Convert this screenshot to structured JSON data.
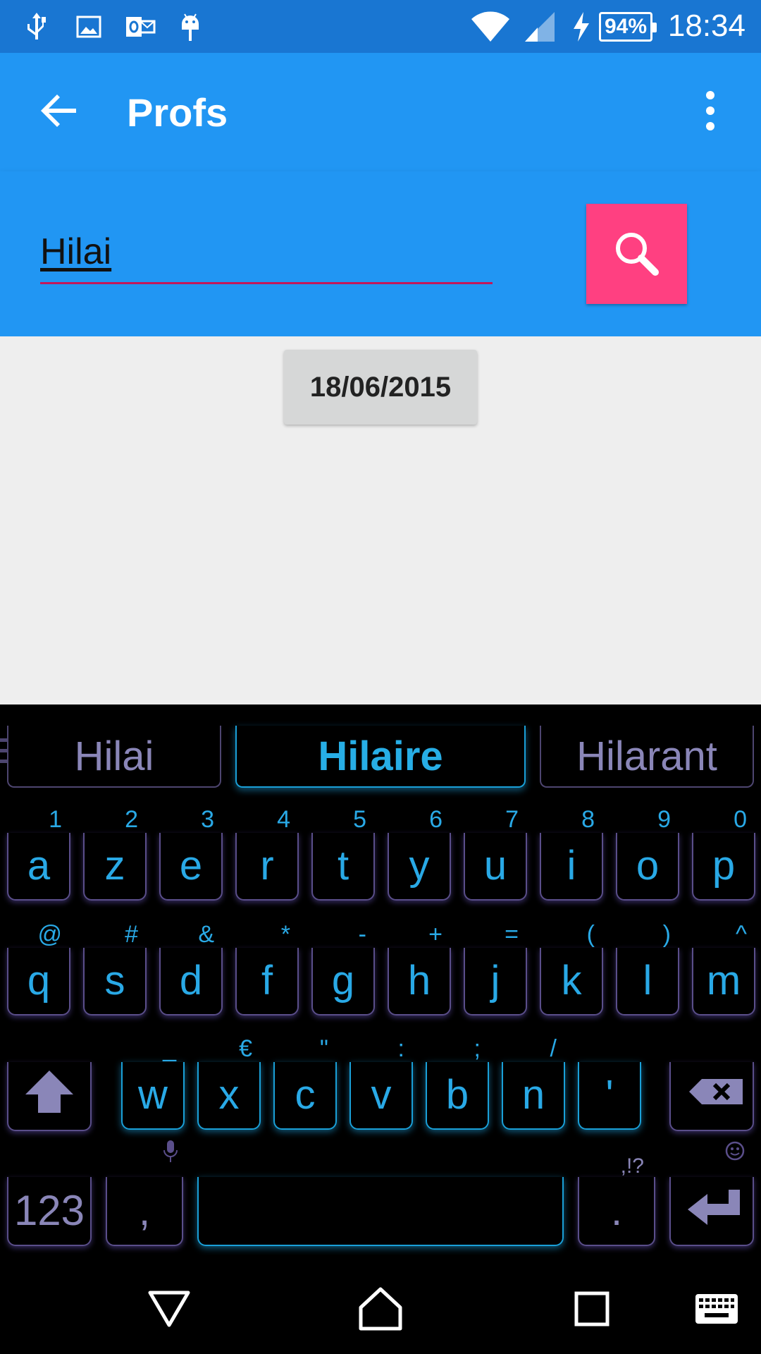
{
  "status_bar": {
    "battery_percent": "94%",
    "time": "18:34",
    "icons": [
      "usb-icon",
      "image-icon",
      "outlook-icon",
      "android-icon",
      "wifi-icon",
      "signal-icon",
      "charging-icon",
      "battery-icon"
    ]
  },
  "app_bar": {
    "title": "Profs",
    "back_icon": "arrow-left-icon",
    "menu_icon": "more-vert-icon"
  },
  "search": {
    "value": "Hilai",
    "button_icon": "search-icon"
  },
  "content": {
    "date_button": "18/06/2015"
  },
  "keyboard": {
    "suggestions": [
      "Hilai",
      "Hilaire",
      "Hilarant"
    ],
    "row1": [
      {
        "key": "a",
        "alt": "1"
      },
      {
        "key": "z",
        "alt": "2"
      },
      {
        "key": "e",
        "alt": "3"
      },
      {
        "key": "r",
        "alt": "4"
      },
      {
        "key": "t",
        "alt": "5"
      },
      {
        "key": "y",
        "alt": "6"
      },
      {
        "key": "u",
        "alt": "7"
      },
      {
        "key": "i",
        "alt": "8"
      },
      {
        "key": "o",
        "alt": "9"
      },
      {
        "key": "p",
        "alt": "0"
      }
    ],
    "row2": [
      {
        "key": "q",
        "alt": "@"
      },
      {
        "key": "s",
        "alt": "#"
      },
      {
        "key": "d",
        "alt": "&"
      },
      {
        "key": "f",
        "alt": "*"
      },
      {
        "key": "g",
        "alt": "-"
      },
      {
        "key": "h",
        "alt": "+"
      },
      {
        "key": "j",
        "alt": "="
      },
      {
        "key": "k",
        "alt": "("
      },
      {
        "key": "l",
        "alt": ")"
      },
      {
        "key": "m",
        "alt": "^"
      }
    ],
    "row3": [
      {
        "key": "w",
        "alt": "_"
      },
      {
        "key": "x",
        "alt": "€"
      },
      {
        "key": "c",
        "alt": "\""
      },
      {
        "key": "v",
        "alt": ":"
      },
      {
        "key": "b",
        "alt": ";"
      },
      {
        "key": "n",
        "alt": "/"
      },
      {
        "key": "'",
        "alt": ""
      }
    ],
    "row4": {
      "numbers": "123",
      "comma": ",",
      "period": ".",
      "period_alt": ",!?"
    }
  },
  "nav_bar": {
    "icons": [
      "back-triangle-icon",
      "home-icon",
      "recents-icon",
      "keyboard-icon"
    ]
  },
  "colors": {
    "status_bar": "#1976D2",
    "app_bar": "#2196F3",
    "accent": "#FF4081",
    "key_blue": "#29a9e6",
    "key_purple": "#8a86b8"
  }
}
